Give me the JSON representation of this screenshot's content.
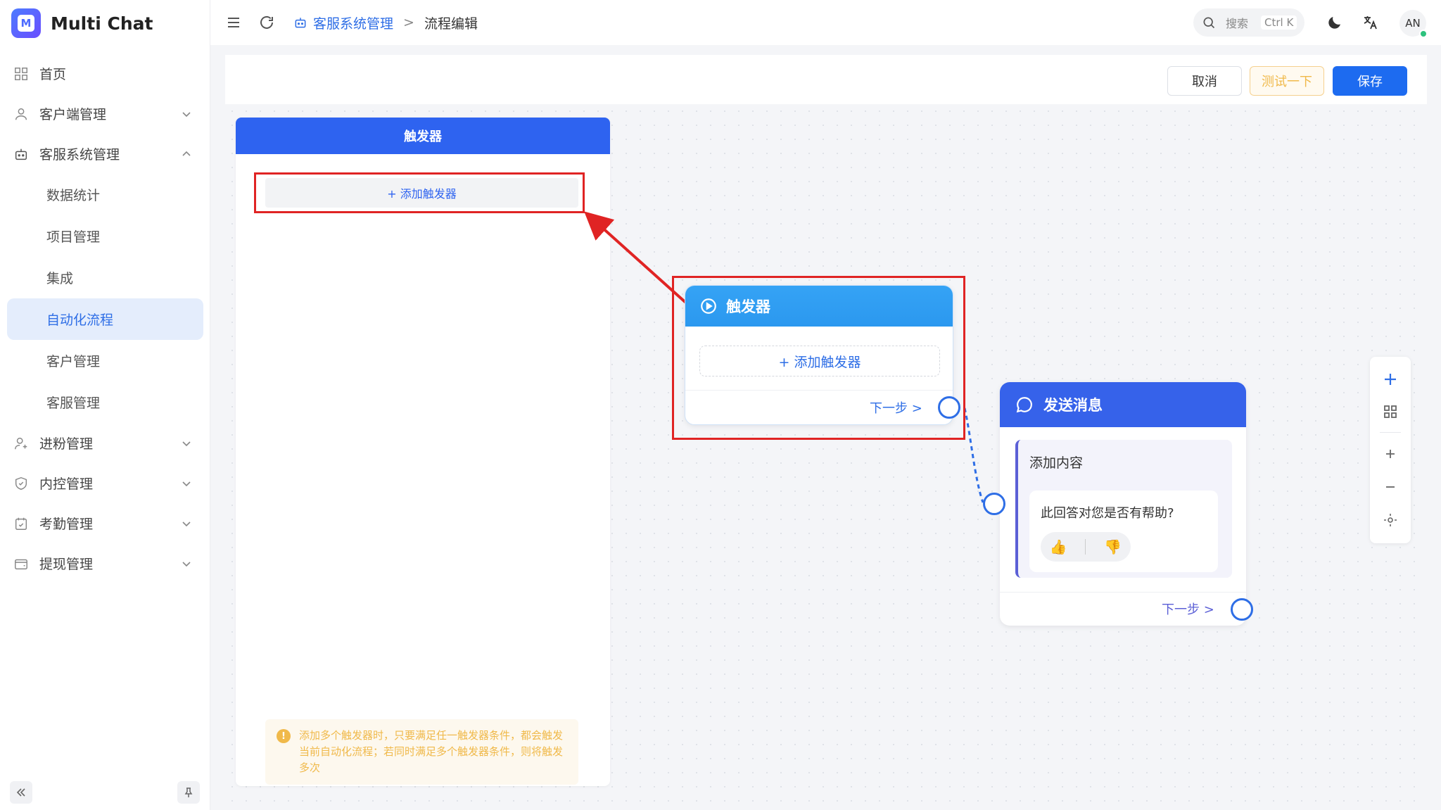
{
  "app": {
    "title": "Multi Chat",
    "logo_letter": "M"
  },
  "sidebar": {
    "items": [
      {
        "label": "首页",
        "icon": "grid-icon",
        "expandable": false
      },
      {
        "label": "客户端管理",
        "icon": "user-icon",
        "expandable": true
      },
      {
        "label": "客服系统管理",
        "icon": "robot-icon",
        "expandable": true,
        "expanded": true
      }
    ],
    "subitems": [
      {
        "label": "数据统计"
      },
      {
        "label": "项目管理"
      },
      {
        "label": "集成"
      },
      {
        "label": "自动化流程",
        "active": true
      },
      {
        "label": "客户管理"
      },
      {
        "label": "客服管理"
      }
    ],
    "items_after": [
      {
        "label": "进粉管理",
        "icon": "user-plus-icon",
        "expandable": true
      },
      {
        "label": "内控管理",
        "icon": "shield-icon",
        "expandable": true
      },
      {
        "label": "考勤管理",
        "icon": "calendar-check-icon",
        "expandable": true
      },
      {
        "label": "提现管理",
        "icon": "wallet-icon",
        "expandable": true
      }
    ]
  },
  "header": {
    "breadcrumb": {
      "parent": "客服系统管理",
      "current": "流程编辑"
    },
    "search": {
      "placeholder": "搜索",
      "shortcut": "Ctrl K"
    },
    "avatar": "AN"
  },
  "toolbar": {
    "cancel": "取消",
    "test": "测试一下",
    "save": "保存"
  },
  "trigger_panel": {
    "title": "触发器",
    "add_label": "+ 添加触发器",
    "note": "添加多个触发器时，只要满足任一触发器条件，都会触发当前自动化流程；若同时满足多个触发器条件，则将触发多次"
  },
  "trigger_node": {
    "title": "触发器",
    "add_label": "+ 添加触发器",
    "next": "下一步 >"
  },
  "message_node": {
    "title": "发送消息",
    "content_title": "添加内容",
    "question": "此回答对您是否有帮助?",
    "like": "👍",
    "dislike": "👎",
    "next": "下一步 >"
  },
  "colors": {
    "primary": "#1d6bf0",
    "trigger_head": "#2b98ef",
    "message_head": "#3662ea",
    "highlight": "#e02424",
    "warning": "#f0b94a"
  }
}
